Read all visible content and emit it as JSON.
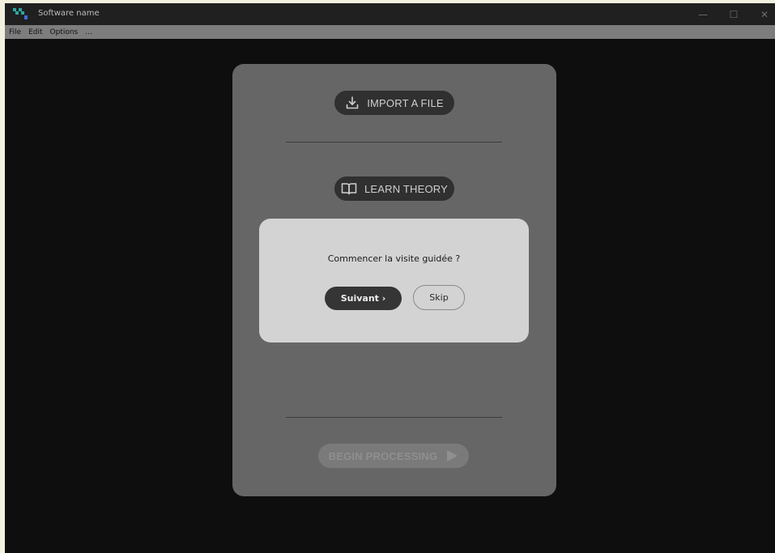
{
  "window": {
    "title": "Software name",
    "controls": {
      "minimize": "—",
      "maximize": "☐",
      "close": "✕"
    }
  },
  "menu": {
    "items": [
      "File",
      "Edit",
      "Options",
      "..."
    ]
  },
  "main": {
    "import_label": "IMPORT A FILE",
    "learn_label": "LEARN THEORY",
    "begin_label": "BEGIN PROCESSING"
  },
  "tour_dialog": {
    "prompt": "Commencer la visite guidée ?",
    "next_label": "Suivant ›",
    "skip_label": "Skip"
  },
  "icons": {
    "app": "app-logo-icon",
    "import": "download-icon",
    "learn": "book-icon",
    "begin": "play-icon"
  },
  "colors": {
    "app_icon_teal": "#2aa7a0",
    "app_icon_blue": "#3a6fd8"
  }
}
